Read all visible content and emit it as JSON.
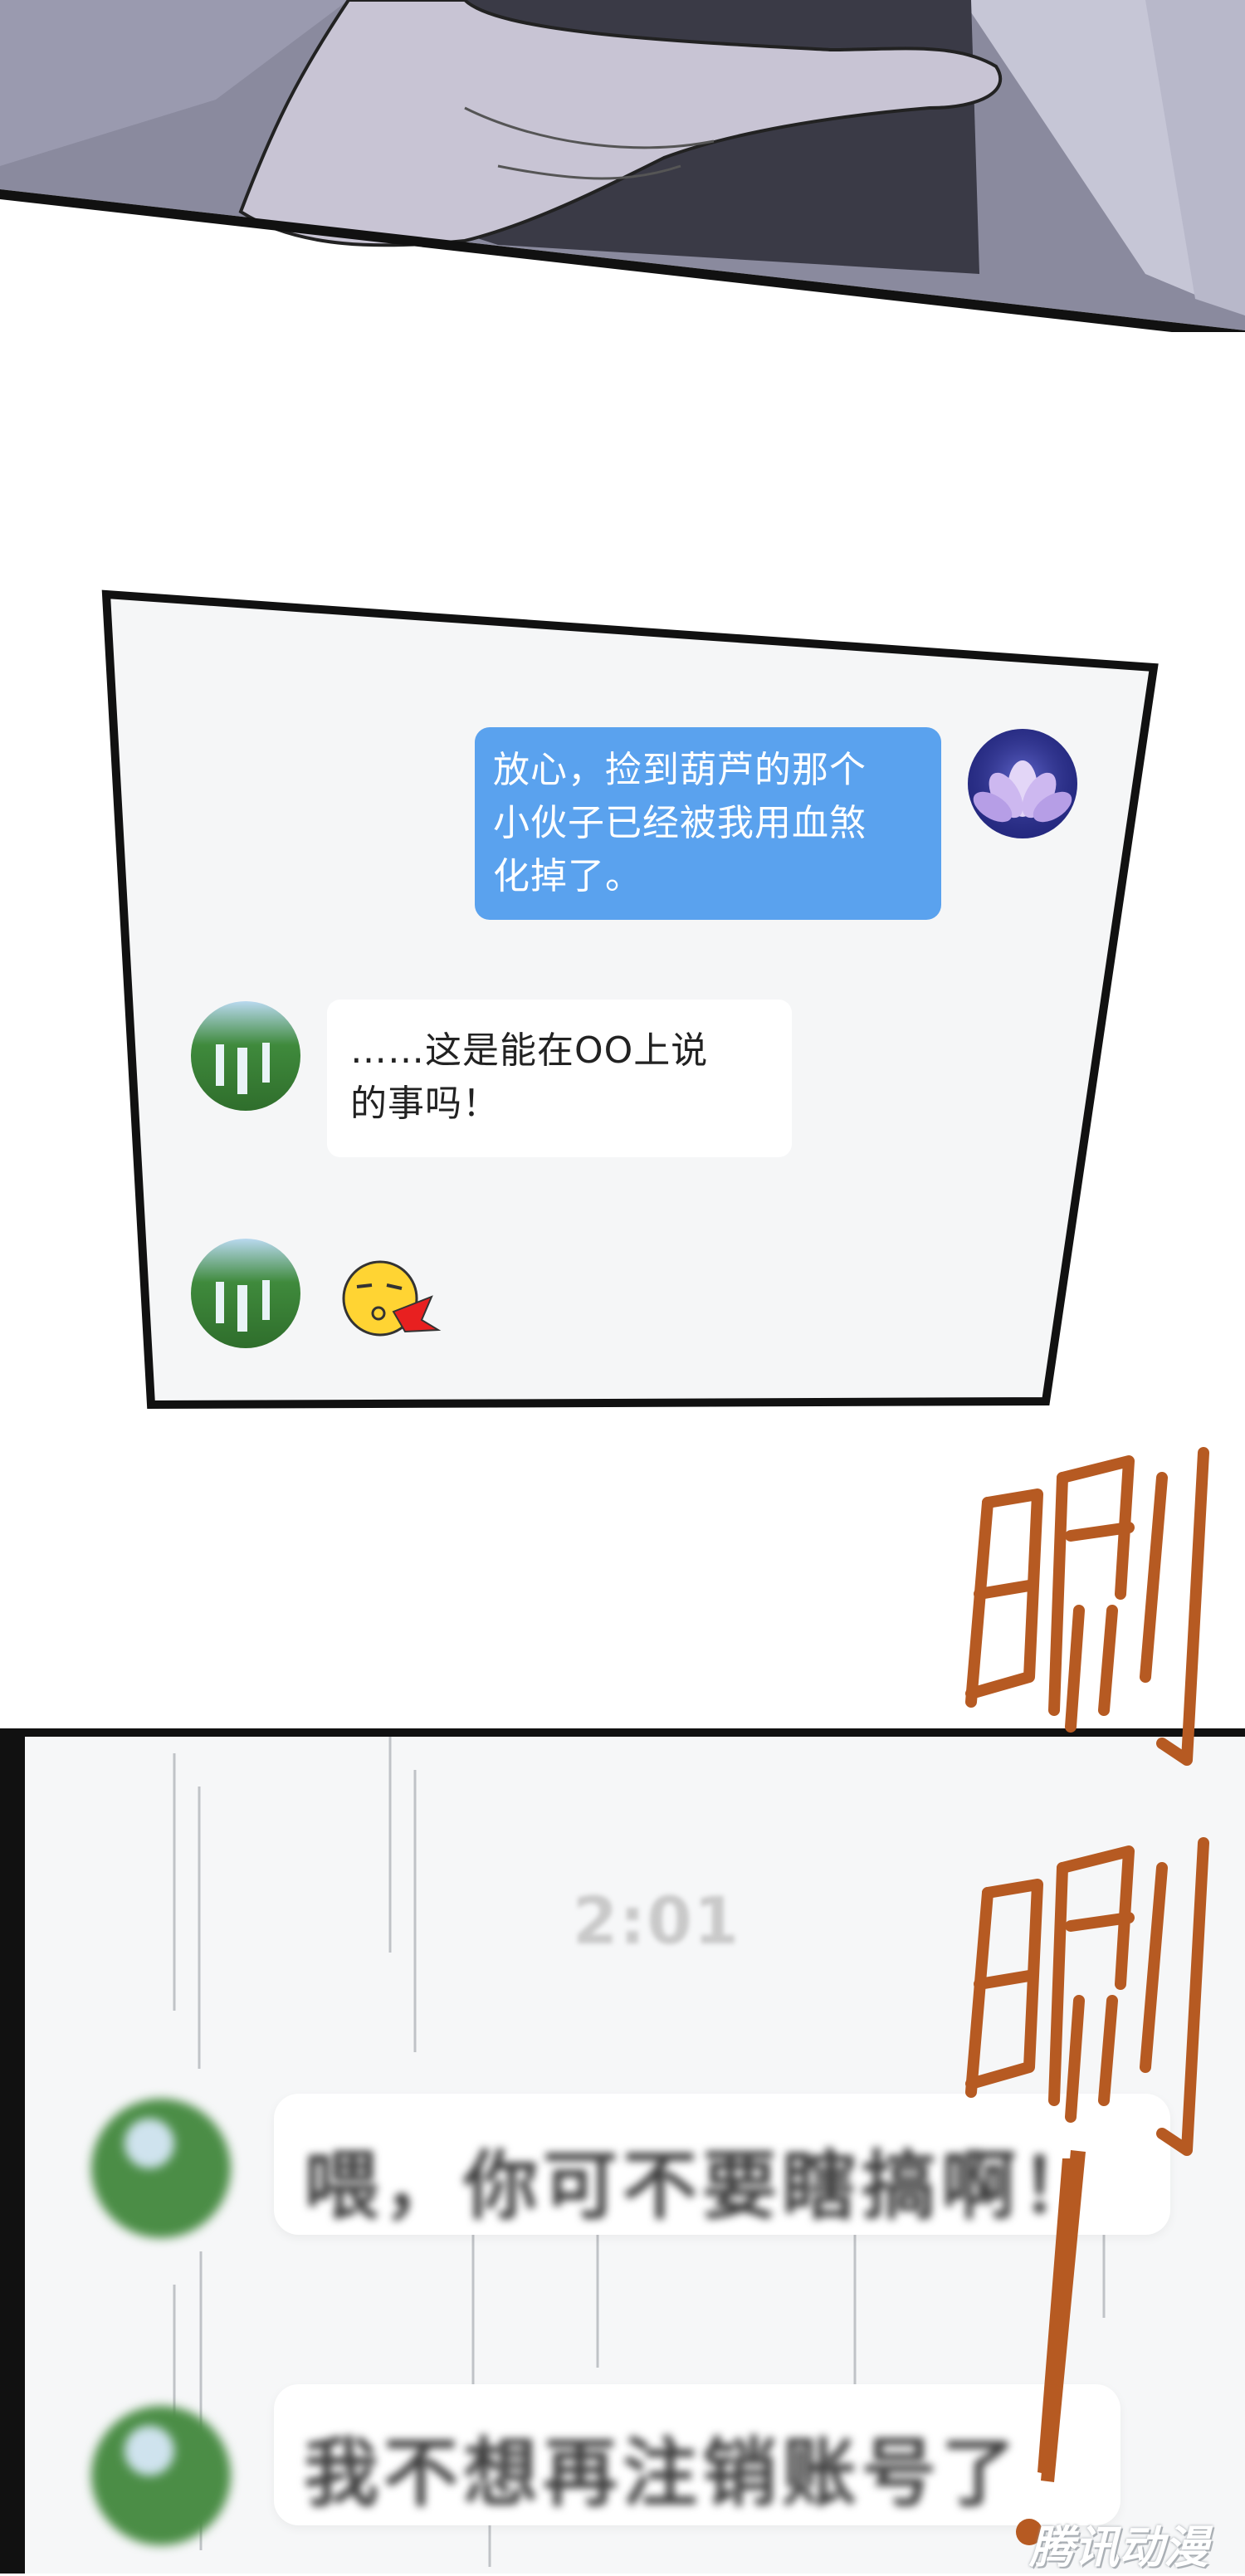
{
  "chat_top": {
    "messages": [
      {
        "side": "right",
        "lines": [
          "放心，捡到葫芦的那个",
          "小伙子已经被我用血煞",
          "化掉了。"
        ]
      },
      {
        "side": "left",
        "lines": [
          "……这是能在OO上说",
          "的事吗！"
        ]
      },
      {
        "side": "left",
        "sticker": "kiss-emoji"
      }
    ],
    "colors": {
      "mine_bubble": "#5aa2ee",
      "other_bubble": "#ffffff",
      "panel_bg": "#f5f6f7"
    }
  },
  "sfx": [
    "唰",
    "唰",
    "！"
  ],
  "chat_blurred": {
    "time": "2:01",
    "messages": [
      {
        "side": "left",
        "text": "喂，你可不要瞎搞啊！"
      },
      {
        "side": "left",
        "text": "我不想再注销账号了"
      }
    ]
  },
  "watermark": "腾讯动漫"
}
